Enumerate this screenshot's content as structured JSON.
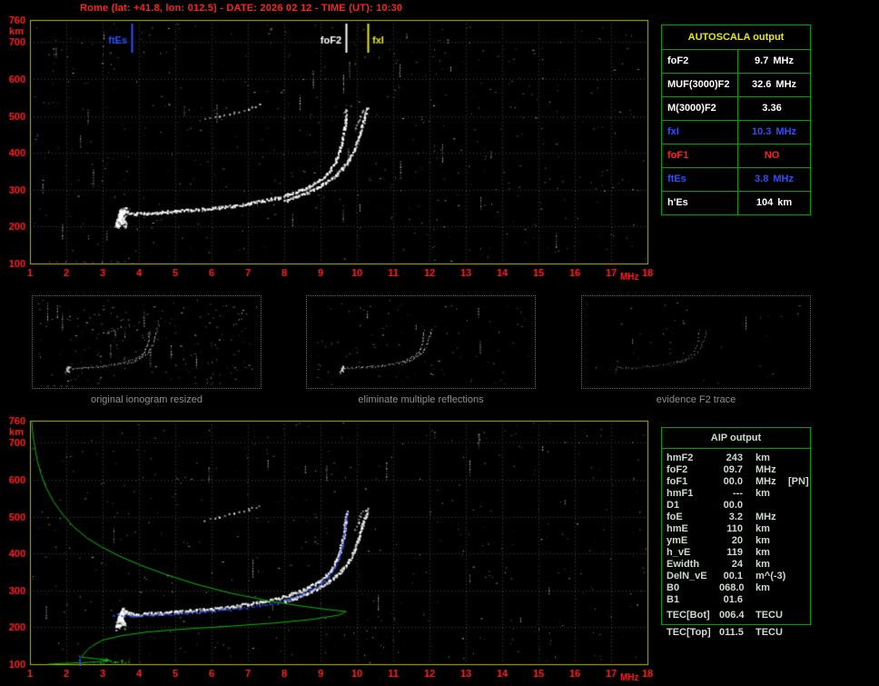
{
  "title": "Rome (lat: +41.8, lon: 012.5) - DATE: 2026 02 12 - TIME (UT): 10:30",
  "colors": {
    "axis_text": "#ff2222",
    "frame": "#b9b900",
    "grid": "#464646",
    "table_border": "#00a000",
    "autoscala_title": "#e8e800",
    "blue": "#2e4eff",
    "red": "#ff2020",
    "white": "#ffffff",
    "profile_green": "#00bb00",
    "caption_gray": "#8f8f8f",
    "aip_text": "#ccdccc"
  },
  "autoscala_table": {
    "title": "AUTOSCALA output",
    "rows": [
      {
        "label": "foF2",
        "value": "9.7",
        "unit": "MHz",
        "color": "#ffffff"
      },
      {
        "label": "MUF(3000)F2",
        "value": "32.6",
        "unit": "MHz",
        "color": "#ffffff"
      },
      {
        "label": "M(3000)F2",
        "value": "3.36",
        "unit": "",
        "color": "#ffffff"
      },
      {
        "label": "fxI",
        "value": "10.3",
        "unit": "MHz",
        "color": "#2e4eff"
      },
      {
        "label": "foF1",
        "value": "NO",
        "unit": "",
        "color": "#ff2020"
      },
      {
        "label": "ftEs",
        "value": "3.8",
        "unit": "MHz",
        "color": "#2e4eff"
      },
      {
        "label": "h'Es",
        "value": "104",
        "unit": "km",
        "color": "#ffffff"
      }
    ]
  },
  "aip_table": {
    "title": "AIP output",
    "rows": [
      {
        "label": "hmF2",
        "value": "243",
        "unit": "km",
        "note": ""
      },
      {
        "label": "foF2",
        "value": "09.7",
        "unit": "MHz",
        "note": ""
      },
      {
        "label": "foF1",
        "value": "00.0",
        "unit": "MHz",
        "note": "[PN]"
      },
      {
        "label": "hmF1",
        "value": "---",
        "unit": "km",
        "note": ""
      },
      {
        "label": "D1",
        "value": "00.0",
        "unit": "",
        "note": ""
      },
      {
        "label": "foE",
        "value": "3.2",
        "unit": "MHz",
        "note": ""
      },
      {
        "label": "hmE",
        "value": "110",
        "unit": "km",
        "note": ""
      },
      {
        "label": "ymE",
        "value": "20",
        "unit": "km",
        "note": ""
      },
      {
        "label": "h_vE",
        "value": "119",
        "unit": "km",
        "note": ""
      },
      {
        "label": "Ewidth",
        "value": "24",
        "unit": "km",
        "note": ""
      },
      {
        "label": "DelN_vE",
        "value": "00.1",
        "unit": "m^(-3)",
        "note": ""
      },
      {
        "label": "B0",
        "value": "068.0",
        "unit": "km",
        "note": ""
      },
      {
        "label": "B1",
        "value": "01.6",
        "unit": "",
        "note": ""
      },
      {
        "label": "TEC[Bot]",
        "value": "006.4",
        "unit": "TECU",
        "note": ""
      },
      {
        "label": "TEC[Top]",
        "value": "011.5",
        "unit": "TECU",
        "note": ""
      }
    ]
  },
  "thumbnails": [
    {
      "caption": "original ionogram resized"
    },
    {
      "caption": "eliminate multiple reflections"
    },
    {
      "caption": "evidence F2 trace"
    }
  ],
  "chart_data": [
    {
      "type": "scatter",
      "name": "top-ionogram",
      "xlabel": "MHz",
      "ylabel": "km",
      "xlim": [
        1,
        18
      ],
      "ylim": [
        100,
        760
      ],
      "x_ticks": [
        1,
        2,
        3,
        4,
        5,
        6,
        7,
        8,
        9,
        10,
        11,
        12,
        13,
        14,
        15,
        16,
        17,
        18
      ],
      "y_ticks": [
        760,
        700,
        600,
        500,
        400,
        300,
        200,
        100
      ],
      "grid": true,
      "annotations": [
        {
          "label": "ftEs",
          "freq": 3.8,
          "color": "#2e4eff",
          "side": "left"
        },
        {
          "label": "foF2",
          "freq": 9.7,
          "color": "#ffffff",
          "side": "left"
        },
        {
          "label": "fxI",
          "freq": 10.3,
          "color": "#e8e800",
          "side": "right"
        }
      ],
      "series": [
        {
          "name": "trace_O",
          "color": "#ffffff",
          "points": [
            [
              3.35,
              205
            ],
            [
              3.45,
              232
            ],
            [
              3.55,
              248
            ],
            [
              3.7,
              240
            ],
            [
              3.9,
              236
            ],
            [
              4.2,
              238
            ],
            [
              4.6,
              240
            ],
            [
              5.0,
              243
            ],
            [
              5.4,
              246
            ],
            [
              5.8,
              249
            ],
            [
              6.2,
              253
            ],
            [
              6.6,
              258
            ],
            [
              7.0,
              264
            ],
            [
              7.4,
              271
            ],
            [
              7.8,
              279
            ],
            [
              8.1,
              288
            ],
            [
              8.4,
              298
            ],
            [
              8.7,
              311
            ],
            [
              8.95,
              326
            ],
            [
              9.15,
              343
            ],
            [
              9.3,
              361
            ],
            [
              9.42,
              383
            ],
            [
              9.52,
              409
            ],
            [
              9.6,
              438
            ],
            [
              9.65,
              467
            ],
            [
              9.68,
              494
            ],
            [
              9.7,
              516
            ]
          ]
        },
        {
          "name": "trace_X",
          "color": "#ffffff",
          "points": [
            [
              8.0,
              271
            ],
            [
              8.3,
              281
            ],
            [
              8.6,
              293
            ],
            [
              8.9,
              306
            ],
            [
              9.15,
              321
            ],
            [
              9.4,
              339
            ],
            [
              9.6,
              359
            ],
            [
              9.78,
              383
            ],
            [
              9.92,
              411
            ],
            [
              10.03,
              441
            ],
            [
              10.12,
              470
            ],
            [
              10.2,
              496
            ],
            [
              10.27,
              521
            ]
          ]
        },
        {
          "name": "blob",
          "color": "#ffffff",
          "points": [
            [
              3.4,
              200
            ],
            [
              3.45,
              212
            ],
            [
              3.5,
              224
            ],
            [
              3.55,
              236
            ],
            [
              3.6,
              246
            ],
            [
              3.5,
              240
            ],
            [
              3.45,
              228
            ],
            [
              3.55,
              216
            ],
            [
              3.6,
              206
            ]
          ]
        },
        {
          "name": "second_hop",
          "color": "#ffffff",
          "points": [
            [
              5.8,
              492
            ],
            [
              6.2,
              500
            ],
            [
              6.6,
              510
            ],
            [
              7.0,
              521
            ],
            [
              7.3,
              531
            ]
          ]
        },
        {
          "name": "asymptote_echo",
          "color": "#ffffff",
          "points": [
            [
              9.95,
              468
            ],
            [
              10.02,
              485
            ],
            [
              10.08,
              502
            ],
            [
              10.15,
              518
            ]
          ]
        },
        {
          "name": "es",
          "color": "#ffffff",
          "points": [
            [
              1.5,
              107
            ],
            [
              2.0,
              105
            ],
            [
              2.5,
              104
            ],
            [
              3.0,
              104
            ],
            [
              3.4,
              104
            ],
            [
              3.8,
              104
            ]
          ]
        }
      ]
    },
    {
      "type": "scatter",
      "name": "bottom-ionogram-with-profile",
      "xlabel": "MHz",
      "ylabel": "km",
      "xlim": [
        1,
        18
      ],
      "ylim": [
        100,
        760
      ],
      "x_ticks": [
        1,
        2,
        3,
        4,
        5,
        6,
        7,
        8,
        9,
        10,
        11,
        12,
        13,
        14,
        15,
        16,
        17,
        18
      ],
      "y_ticks": [
        760,
        700,
        600,
        500,
        400,
        300,
        200,
        100
      ],
      "grid": true,
      "annotations": [],
      "series": [
        {
          "name": "trace_O",
          "color": "#ffffff",
          "points": [
            [
              3.35,
              205
            ],
            [
              3.45,
              232
            ],
            [
              3.55,
              248
            ],
            [
              3.7,
              240
            ],
            [
              3.9,
              236
            ],
            [
              4.2,
              238
            ],
            [
              4.6,
              240
            ],
            [
              5.0,
              243
            ],
            [
              5.4,
              246
            ],
            [
              5.8,
              249
            ],
            [
              6.2,
              253
            ],
            [
              6.6,
              258
            ],
            [
              7.0,
              264
            ],
            [
              7.4,
              271
            ],
            [
              7.8,
              279
            ],
            [
              8.1,
              288
            ],
            [
              8.4,
              298
            ],
            [
              8.7,
              311
            ],
            [
              8.95,
              326
            ],
            [
              9.15,
              343
            ],
            [
              9.3,
              361
            ],
            [
              9.42,
              383
            ],
            [
              9.52,
              409
            ],
            [
              9.6,
              438
            ],
            [
              9.65,
              467
            ],
            [
              9.68,
              494
            ],
            [
              9.7,
              516
            ]
          ]
        },
        {
          "name": "trace_X",
          "color": "#ffffff",
          "points": [
            [
              8.0,
              271
            ],
            [
              8.3,
              281
            ],
            [
              8.6,
              293
            ],
            [
              8.9,
              306
            ],
            [
              9.15,
              321
            ],
            [
              9.4,
              339
            ],
            [
              9.6,
              359
            ],
            [
              9.78,
              383
            ],
            [
              9.92,
              411
            ],
            [
              10.03,
              441
            ],
            [
              10.12,
              470
            ],
            [
              10.2,
              496
            ],
            [
              10.27,
              521
            ]
          ]
        },
        {
          "name": "blob",
          "color": "#ffffff",
          "points": [
            [
              3.4,
              200
            ],
            [
              3.45,
              212
            ],
            [
              3.5,
              224
            ],
            [
              3.55,
              236
            ],
            [
              3.6,
              246
            ],
            [
              3.5,
              240
            ],
            [
              3.45,
              228
            ],
            [
              3.55,
              216
            ],
            [
              3.6,
              206
            ]
          ]
        },
        {
          "name": "second_hop",
          "color": "#ffffff",
          "points": [
            [
              5.8,
              492
            ],
            [
              6.2,
              500
            ],
            [
              6.6,
              510
            ],
            [
              7.0,
              521
            ],
            [
              7.3,
              531
            ]
          ]
        },
        {
          "name": "asymptote_echo",
          "color": "#ffffff",
          "points": [
            [
              9.95,
              468
            ],
            [
              10.02,
              485
            ],
            [
              10.08,
              502
            ],
            [
              10.15,
              518
            ]
          ]
        },
        {
          "name": "es",
          "color": "#ffffff",
          "points": [
            [
              2.0,
              104
            ],
            [
              2.5,
              106
            ],
            [
              3.0,
              104
            ],
            [
              3.5,
              105
            ],
            [
              4.0,
              104
            ]
          ]
        },
        {
          "name": "restored_trace",
          "color": "#3a5aff",
          "points": [
            [
              3.3,
              236
            ],
            [
              3.8,
              232
            ],
            [
              4.3,
              234
            ],
            [
              4.8,
              237
            ],
            [
              5.3,
              240
            ],
            [
              5.8,
              244
            ],
            [
              6.3,
              248
            ],
            [
              6.8,
              253
            ],
            [
              7.3,
              260
            ],
            [
              7.8,
              268
            ],
            [
              8.1,
              278
            ],
            [
              8.45,
              291
            ],
            [
              8.75,
              305
            ],
            [
              9.0,
              321
            ],
            [
              9.2,
              340
            ],
            [
              9.38,
              362
            ],
            [
              9.5,
              388
            ],
            [
              9.58,
              418
            ],
            [
              9.64,
              450
            ],
            [
              9.68,
              482
            ],
            [
              9.7,
              512
            ]
          ]
        },
        {
          "name": "profile",
          "color": "#00bb00",
          "points": [
            [
              1.05,
              760
            ],
            [
              1.08,
              722
            ],
            [
              1.13,
              690
            ],
            [
              1.2,
              652
            ],
            [
              1.3,
              616
            ],
            [
              1.45,
              577
            ],
            [
              1.65,
              540
            ],
            [
              1.9,
              506
            ],
            [
              2.2,
              472
            ],
            [
              2.6,
              440
            ],
            [
              3.0,
              416
            ],
            [
              3.5,
              391
            ],
            [
              4.1,
              366
            ],
            [
              4.8,
              341
            ],
            [
              5.6,
              316
            ],
            [
              6.5,
              293
            ],
            [
              7.5,
              273
            ],
            [
              8.5,
              257
            ],
            [
              9.3,
              247
            ],
            [
              9.7,
              243
            ],
            [
              9.5,
              233
            ],
            [
              8.8,
              222
            ],
            [
              7.8,
              212
            ],
            [
              6.5,
              203
            ],
            [
              5.2,
              195
            ],
            [
              4.2,
              187
            ],
            [
              3.5,
              177
            ],
            [
              3.0,
              165
            ],
            [
              2.75,
              152
            ],
            [
              2.6,
              141
            ],
            [
              2.5,
              130
            ],
            [
              2.44,
              122
            ],
            [
              2.42,
              119
            ],
            [
              2.8,
              115
            ],
            [
              3.15,
              111
            ],
            [
              3.2,
              110
            ],
            [
              2.9,
              107
            ],
            [
              2.4,
              104
            ],
            [
              1.9,
              102
            ],
            [
              1.5,
              100
            ]
          ]
        },
        {
          "name": "e_marks",
          "color": "#00cc33",
          "points": [
            [
              2.9,
              108
            ],
            [
              3.1,
              112
            ],
            [
              3.3,
              106
            ],
            [
              3.5,
              110
            ],
            [
              3.7,
              105
            ]
          ]
        },
        {
          "name": "e_dash",
          "color": "#3a5aff",
          "points": [
            [
              2.35,
              100
            ],
            [
              2.35,
              112
            ],
            [
              2.35,
              124
            ]
          ]
        }
      ]
    }
  ]
}
